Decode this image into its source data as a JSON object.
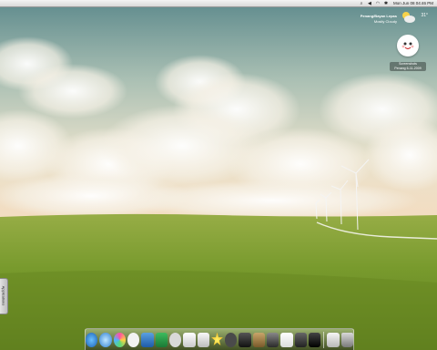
{
  "menubar": {
    "clock": "Mon Jun 08 04:46 PM",
    "icons": [
      "spotlight-icon",
      "volume-icon",
      "wifi-icon",
      "bluetooth-icon"
    ]
  },
  "weather": {
    "location": "Penang/Bayan Lepas",
    "condition": "Mostly Cloudy",
    "temperature": "31°"
  },
  "desktop_icon": {
    "label_line1": "Screenshots",
    "label_line2": "Penang 6-11-2009"
  },
  "sidebar_tab": {
    "label": "Applications"
  },
  "dock": {
    "items": [
      "finder-icon",
      "safari-icon",
      "itunes-icon",
      "ichat-icon",
      "mail-icon",
      "xcode-icon",
      "photoshop-icon",
      "preview-icon",
      "textedit-icon",
      "favorites-icon",
      "gimp-icon",
      "camera-icon",
      "iphoto-icon",
      "speaker-icon",
      "document-icon",
      "calculator-icon",
      "finalcut-icon",
      "pen-tablet-icon",
      "trash-icon"
    ]
  },
  "colors": {
    "sky_top": "#5c8a8a",
    "sky_mid": "#d9e0cc",
    "horizon": "#f3dfc4",
    "grass": "#7a9a2e",
    "grass_dark": "#56731d"
  }
}
